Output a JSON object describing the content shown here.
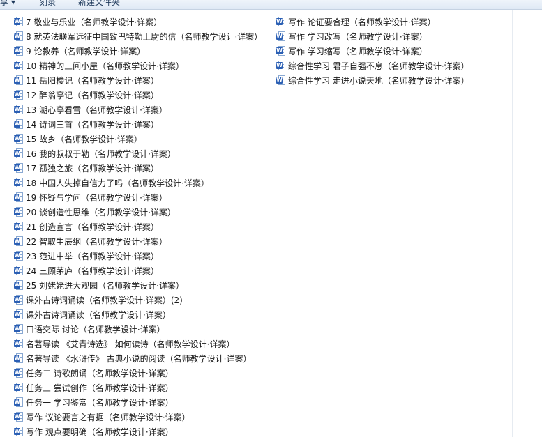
{
  "toolbar": {
    "items": [
      "享 ▾",
      "刻录",
      "新建文件夹"
    ]
  },
  "files": {
    "icon": "word-document-icon",
    "badge_letter": "W",
    "column1": [
      "7 敬业与乐业（名师教学设计·详案）",
      "8 就英法联军远征中国致巴特勒上尉的信（名师教学设计·详案）",
      "9 论教养（名师教学设计·详案）",
      "10 精神的三间小屋（名师教学设计·详案）",
      "11 岳阳楼记（名师教学设计·详案）",
      "12 醉翁亭记（名师教学设计·详案）",
      "13 湖心亭看雪（名师教学设计·详案）",
      "14 诗词三首（名师教学设计·详案）",
      "15 故乡（名师教学设计·详案）",
      "16 我的叔叔于勒（名师教学设计·详案）",
      "17 孤独之旅（名师教学设计·详案）",
      "18 中国人失掉自信力了吗（名师教学设计·详案）",
      "19 怀疑与学问（名师教学设计·详案）",
      "20 谈创造性思维（名师教学设计·详案）",
      "21 创造宣言（名师教学设计·详案）",
      "22 智取生辰纲（名师教学设计·详案）",
      "23 范进中举（名师教学设计·详案）",
      "24 三顾茅庐（名师教学设计·详案）",
      "25 刘姥姥进大观园（名师教学设计·详案）",
      "课外古诗词诵读（名师教学设计·详案）(2)",
      "课外古诗词诵读（名师教学设计·详案）",
      "口语交际 讨论（名师教学设计·详案）",
      "名著导读 《艾青诗选》 如何读诗（名师教学设计·详案）",
      "名著导读 《水浒传》 古典小说的阅读（名师教学设计·详案）",
      "任务二 诗歌朗诵（名师教学设计·详案）",
      "任务三 尝试创作（名师教学设计·详案）",
      "任务一 学习鉴赏（名师教学设计·详案）",
      "写作 议论要言之有据（名师教学设计·详案）",
      "写作 观点要明确（名师教学设计·详案）"
    ],
    "column2": [
      "写作 论证要合理（名师教学设计·详案）",
      "写作 学习改写（名师教学设计·详案）",
      "写作 学习缩写（名师教学设计·详案）",
      "综合性学习 君子自强不息（名师教学设计·详案）",
      "综合性学习 走进小说天地（名师教学设计·详案）"
    ]
  }
}
